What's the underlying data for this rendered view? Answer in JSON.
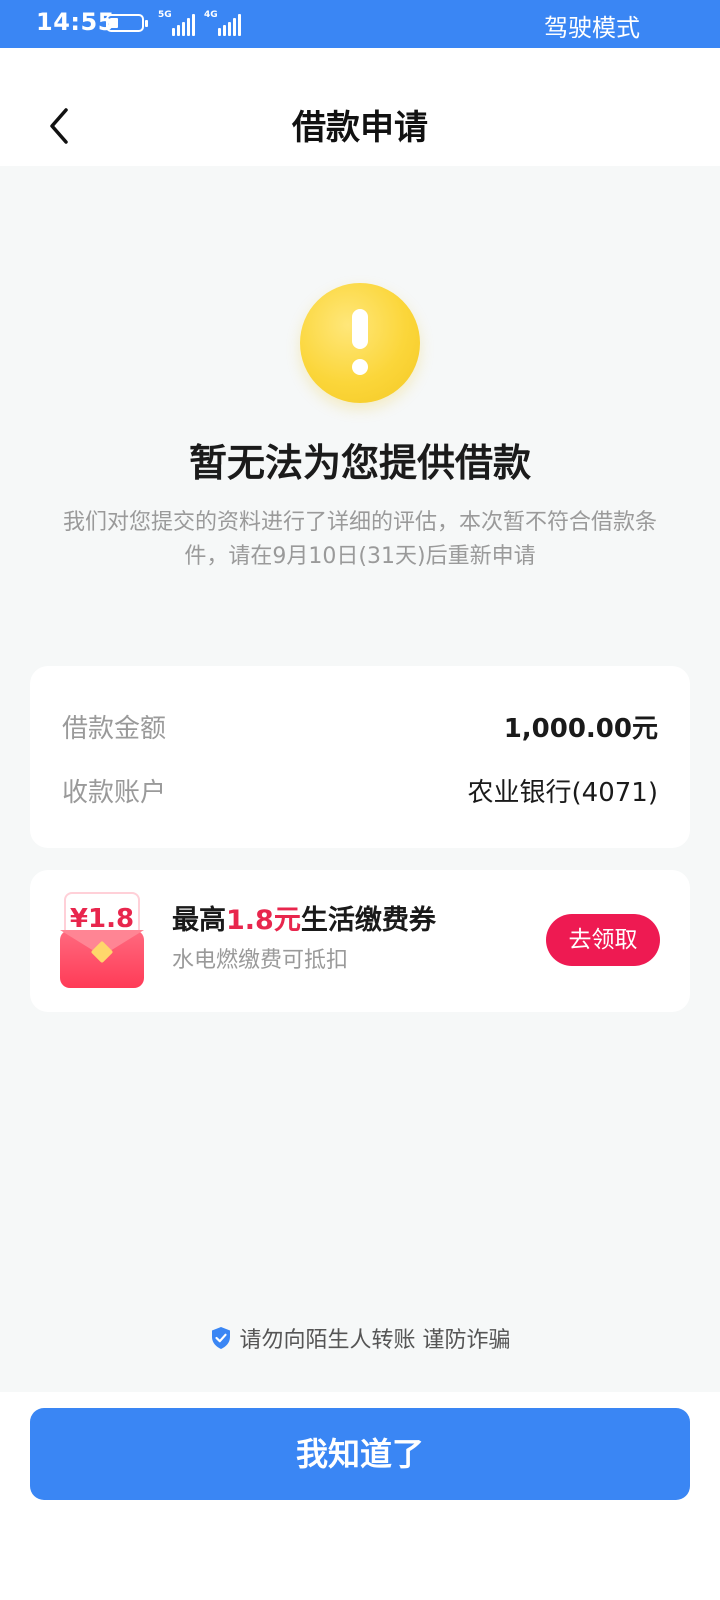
{
  "status_bar": {
    "time": "14:55",
    "signal1_tag": "5G",
    "signal2_tag": "4G",
    "mode_label": "驾驶模式",
    "color": "#3a86f4"
  },
  "nav": {
    "title": "借款申请",
    "back_icon": "chevron-left-icon"
  },
  "result": {
    "icon": "warning-icon",
    "headline": "暂无法为您提供借款",
    "description": "我们对您提交的资料进行了详细的评估，本次暂不符合借款条件，请在9月10日(31天)后重新申请"
  },
  "loan_info": {
    "amount_label": "借款金额",
    "amount_value": "1,000.00元",
    "account_label": "收款账户",
    "account_value": "农业银行(4071)"
  },
  "promo": {
    "envelope_amount": "¥1.8",
    "title_prefix": "最高",
    "title_highlight": "1.8元",
    "title_suffix": "生活缴费券",
    "subtitle": "水电燃缴费可抵扣",
    "button_label": "去领取",
    "accent_color": "#e8264d"
  },
  "safety_notice": {
    "icon": "shield-check-icon",
    "text": "请勿向陌生人转账 谨防诈骗"
  },
  "footer": {
    "confirm_label": "我知道了",
    "button_color": "#3a86f4"
  }
}
